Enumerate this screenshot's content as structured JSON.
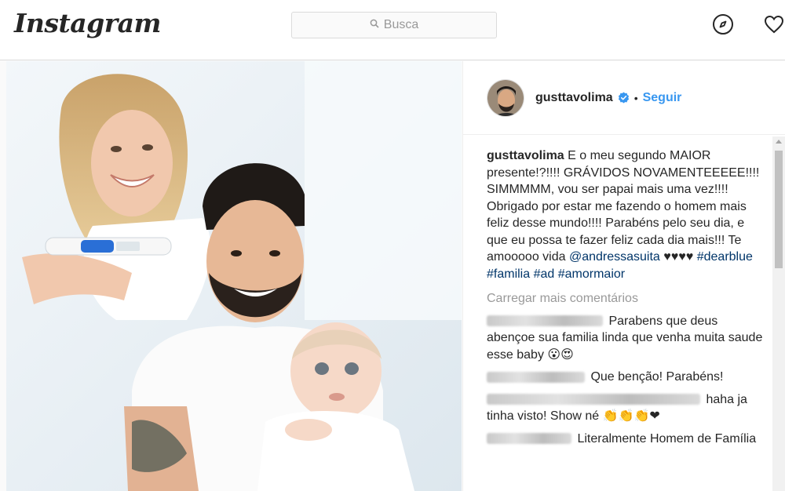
{
  "app": {
    "logo": "Instagram"
  },
  "search": {
    "placeholder": "Busca"
  },
  "post": {
    "author": {
      "username": "gusttavolima",
      "follow_label": "Seguir",
      "separator": "•"
    },
    "caption": {
      "username": "gusttavolima",
      "text": "E o meu segundo MAIOR presente!?!!!! GRÁVIDOS NOVAMENTEEEEE!!!! SIMMMMM, vou ser papai mais uma vez!!!! Obrigado por estar me fazendo o homem mais feliz desse mundo!!!! Parabéns pelo seu dia, e que eu possa te fazer feliz cada dia mais!!! Te amooooo vida",
      "mention": "@andressasuita",
      "hearts": "♥♥♥♥",
      "hashtags": [
        "#dearblue",
        "#familia",
        "#ad",
        "#amormaior"
      ]
    },
    "load_more": "Carregar mais comentários",
    "comments": [
      {
        "text": "Parabens que deus abençoe sua familia linda que venha muita saude esse baby 😮😍"
      },
      {
        "text": "Que benção! Parabéns!"
      },
      {
        "text": "haha ja tinha visto! Show né 👏👏👏❤"
      },
      {
        "text": "Literalmente Homem de Família"
      }
    ]
  },
  "colors": {
    "link": "#3897f0",
    "tag": "#003569",
    "border": "#dbdbdb"
  },
  "icons": [
    "search-icon",
    "compass-icon",
    "heart-icon",
    "verified-badge-icon"
  ]
}
